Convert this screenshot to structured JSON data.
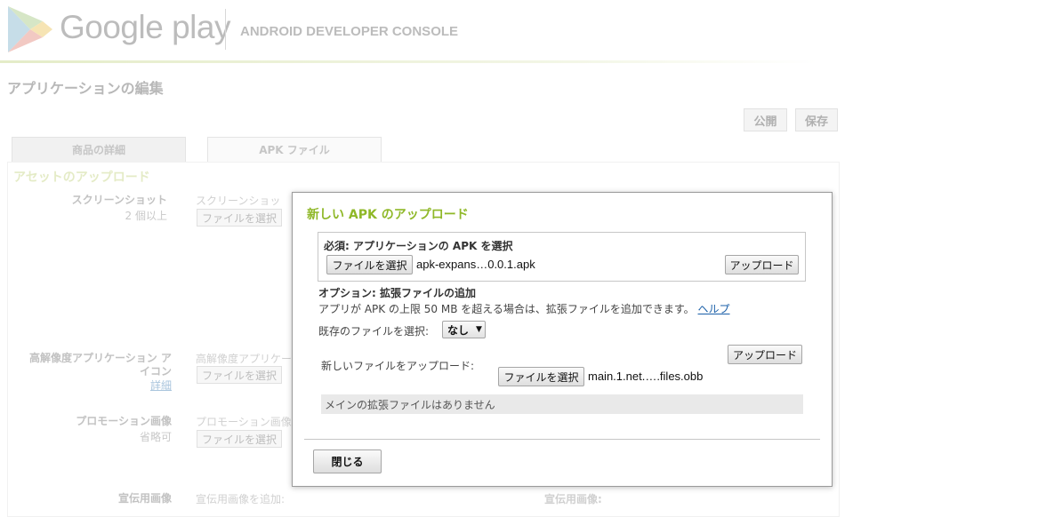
{
  "header": {
    "brand": "Google play",
    "console_title": "ANDROID DEVELOPER CONSOLE"
  },
  "page": {
    "title": "アプリケーションの編集",
    "publish_label": "公開",
    "save_label": "保存",
    "tabs": [
      {
        "label": "商品の詳細"
      },
      {
        "label": "APK ファイル"
      }
    ],
    "section_title": "アセットのアップロード",
    "fields": [
      {
        "label": "スクリーンショット",
        "sub": "2 個以上",
        "hint": "スクリーンショッ",
        "button": "ファイルを選択"
      },
      {
        "label_line1": "高解像度アプリケーション ア",
        "label_line2": "イコン",
        "link": "詳細",
        "hint": "高解像度アプリケー",
        "button": "ファイルを選択"
      },
      {
        "label": "プロモーション画像",
        "sub": "省略可",
        "hint": "プロモーション画像",
        "button": "ファイルを選択"
      },
      {
        "label": "宣伝用画像",
        "hint": "宣伝用画像を追加:",
        "hint_right": "宣伝用画像:"
      }
    ]
  },
  "modal": {
    "title": "新しい APK のアップロード",
    "required_label": "必須: アプリケーションの APK を選択",
    "choose_file_label": "ファイルを選択",
    "apk_filename": "apk-expans…0.0.1.apk",
    "upload_label": "アップロード",
    "optional_label": "オプション: 拡張ファイルの追加",
    "optional_desc": "アプリが APK の上限 50 MB を超える場合は、拡張ファイルを追加できます。",
    "help_link": "ヘルプ",
    "existing_label": "既存のファイルを選択:",
    "existing_value": "なし",
    "upload2_label": "アップロード",
    "new_file_label": "新しいファイルをアップロード:",
    "choose_file2_label": "ファイルを選択",
    "obb_filename": "main.1.net.….files.obb",
    "status": "メインの拡張ファイルはありません",
    "close_label": "閉じる"
  }
}
